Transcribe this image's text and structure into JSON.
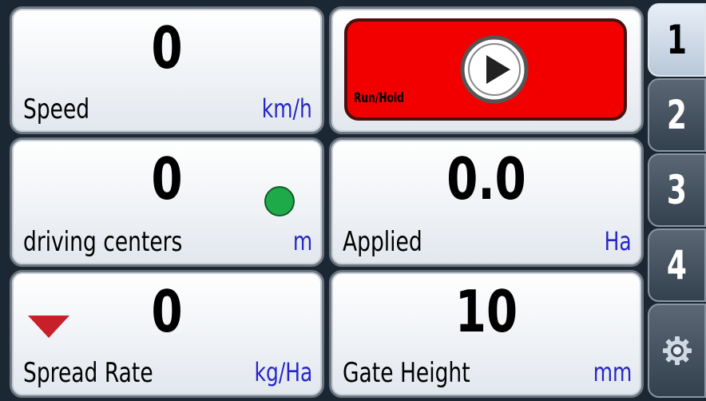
{
  "tiles": {
    "speed": {
      "value": "0",
      "label": "Speed",
      "unit": "km/h"
    },
    "run_hold": {
      "label": "Run/Hold"
    },
    "driving_centers": {
      "value": "0",
      "label": "driving centers",
      "unit": "m",
      "indicator_color": "#1faa4a"
    },
    "applied": {
      "value": "0.0",
      "label": "Applied",
      "unit": "Ha"
    },
    "spread_rate": {
      "value": "0",
      "label": "Spread Rate",
      "unit": "kg/Ha",
      "indicator_color": "#c8202a"
    },
    "gate_height": {
      "value": "10",
      "label": "Gate Height",
      "unit": "mm"
    }
  },
  "side_tabs": [
    {
      "label": "1",
      "active": true
    },
    {
      "label": "2",
      "active": false
    },
    {
      "label": "3",
      "active": false
    },
    {
      "label": "4",
      "active": false
    },
    {
      "icon": "gear-icon",
      "active": false
    }
  ],
  "colors": {
    "run_button": "#f20000",
    "unit_text": "#2626c8",
    "background": "#1b2733"
  }
}
